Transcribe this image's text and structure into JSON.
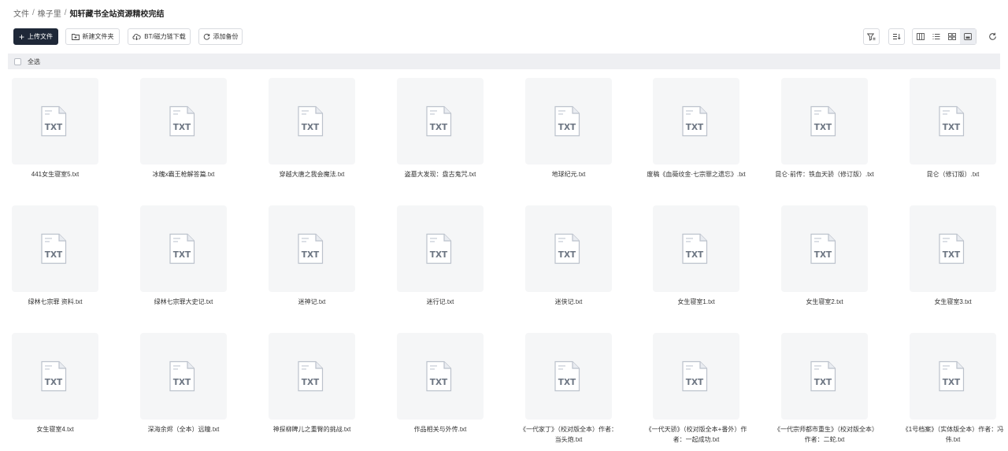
{
  "breadcrumb": {
    "items": [
      "文件",
      "橡子里"
    ],
    "current": "知轩藏书全站资源精校完结"
  },
  "toolbar": {
    "upload": "上传文件",
    "new_folder": "新建文件夹",
    "bt_download": "BT/磁力链下载",
    "add_backup": "添加备份"
  },
  "select_all": "全选",
  "icon_label": "TXT",
  "files": [
    "441女生寝室5.txt",
    "冰魄x霸王枪解答篇.txt",
    "穿越大唐之我会魔法.txt",
    "盗墓大发现：盘古鬼咒.txt",
    "地球纪元.txt",
    "废稿《血薇纹金·七宗罪之遗忘》.txt",
    "昆仑·前传：铁血天骄（修订版）.txt",
    "昆仑（修订版）.txt",
    "绿林七宗罪 资料.txt",
    "绿林七宗罪大史记.txt",
    "迷神记.txt",
    "迷行记.txt",
    "迷侠记.txt",
    "女生寝室1.txt",
    "女生寝室2.txt",
    "女生寝室3.txt",
    "女生寝室4.txt",
    "深海余烬（全本）远瞳.txt",
    "神探柳睥儿之重臀的挑战.txt",
    "作品相关与外传.txt",
    "《一代家丁》（校对版全本）作者：当头炮.txt",
    "《一代天骄》（校对版全本+番外）作者：一起成功.txt",
    "《一代宗师都市重生》（校对版全本）作者：二蛇.txt",
    "《1号档案》（实体版全本）作者：冯伟.txt"
  ]
}
